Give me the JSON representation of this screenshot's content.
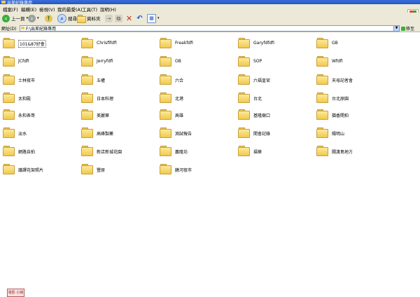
{
  "window": {
    "title": "出差紀錄專用"
  },
  "menu": [
    "檔案(F)",
    "編輯(E)",
    "檢視(V)",
    "我的最愛(A)",
    "工具(T)",
    "說明(H)"
  ],
  "toolbar": {
    "back": "上一頁",
    "search": "搜尋",
    "folders": "資料夾"
  },
  "address": {
    "label": "網址(D)",
    "path": "F:\\出差紀錄專用",
    "go": "移至"
  },
  "folders": [
    "101&87好會",
    "Chrisfifdfi",
    "Freakfdfi",
    "Garyfdfdfi",
    "GB",
    "JCfdfi",
    "Jerryfdfi",
    "OB",
    "SOP",
    "Wfdfi",
    "士林夜市",
    "五權",
    "六合",
    "六福皇宮",
    "天母記者會",
    "太和殿",
    "日本料理",
    "北港",
    "台北",
    "台北原園",
    "永和表哥",
    "美麗華",
    "高雄",
    "基隆廟口",
    "猶香開拍",
    "淡水",
    "高峰製藥",
    "測試報告",
    "開會記錄",
    "陽明山",
    "網路自拍",
    "新店新城花園",
    "義隆坊",
    "福華",
    "關渡島地方",
    "議譯花架照片",
    "豐原",
    "饒河夜市"
  ],
  "stamp": "電影 小綠"
}
